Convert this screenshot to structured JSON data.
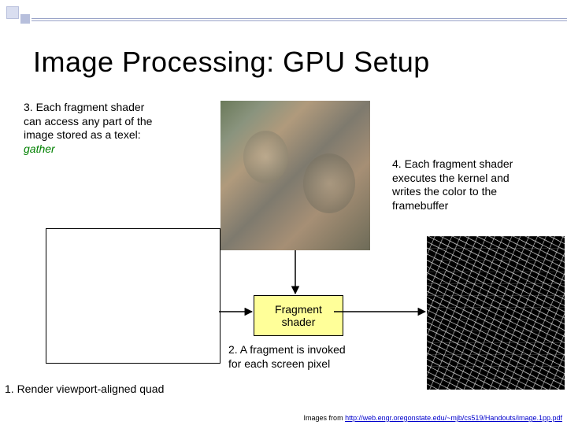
{
  "title": "Image Processing:  GPU Setup",
  "step3": {
    "line1": "3. Each fragment shader",
    "line2": "can access any part of the",
    "line3": "image stored as a texel:",
    "gather": "gather"
  },
  "step4": {
    "line1": "4. Each fragment shader",
    "line2": "executes the kernel and",
    "line3": "writes the color to the",
    "line4": "framebuffer"
  },
  "fragment_box": {
    "line1": "Fragment",
    "line2": "shader"
  },
  "step2": {
    "line1": "2. A fragment is invoked",
    "line2": "for each screen pixel"
  },
  "step1": "1. Render viewport-aligned quad",
  "citation_prefix": "Images from ",
  "citation_url": "http://web.engr.oregonstate.edu/~mjb/cs519/Handouts/image.1pp.pdf",
  "colors": {
    "frag_bg": "#ffff99",
    "gather": "#008000"
  }
}
